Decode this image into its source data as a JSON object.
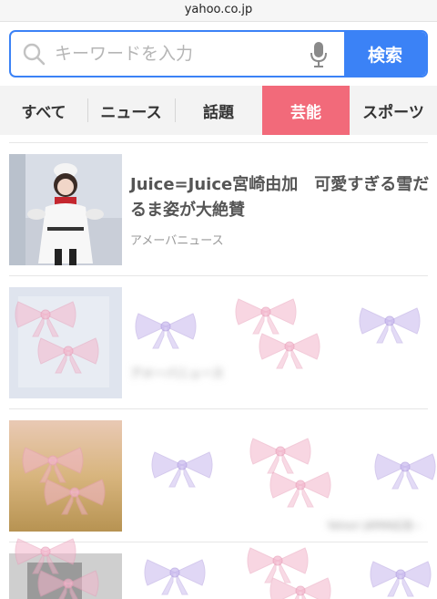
{
  "url": "yahoo.co.jp",
  "search": {
    "placeholder": "キーワードを入力",
    "button_label": "検索"
  },
  "tabs": [
    {
      "label": "すべて",
      "active": false
    },
    {
      "label": "ニュース",
      "active": false
    },
    {
      "label": "話題",
      "active": false
    },
    {
      "label": "芸能",
      "active": true
    },
    {
      "label": "スポーツ",
      "active": false
    }
  ],
  "articles": [
    {
      "title": "Juice=Juice宮崎由加　可愛すぎる雪だるま姿が大絶賛",
      "source": "アメーバニュース"
    },
    {
      "title": "",
      "source": "アメーバニュース"
    },
    {
      "title": "",
      "source": "",
      "extra": "Yahoo! JAPAN広告"
    },
    {
      "title": "",
      "source": ""
    }
  ],
  "colors": {
    "accent_blue": "#3b82f6",
    "active_tab": "#f26a7a"
  },
  "icons": {
    "search": "search-icon",
    "mic": "microphone-icon",
    "ad_arrow": "chevron-right-icon"
  }
}
